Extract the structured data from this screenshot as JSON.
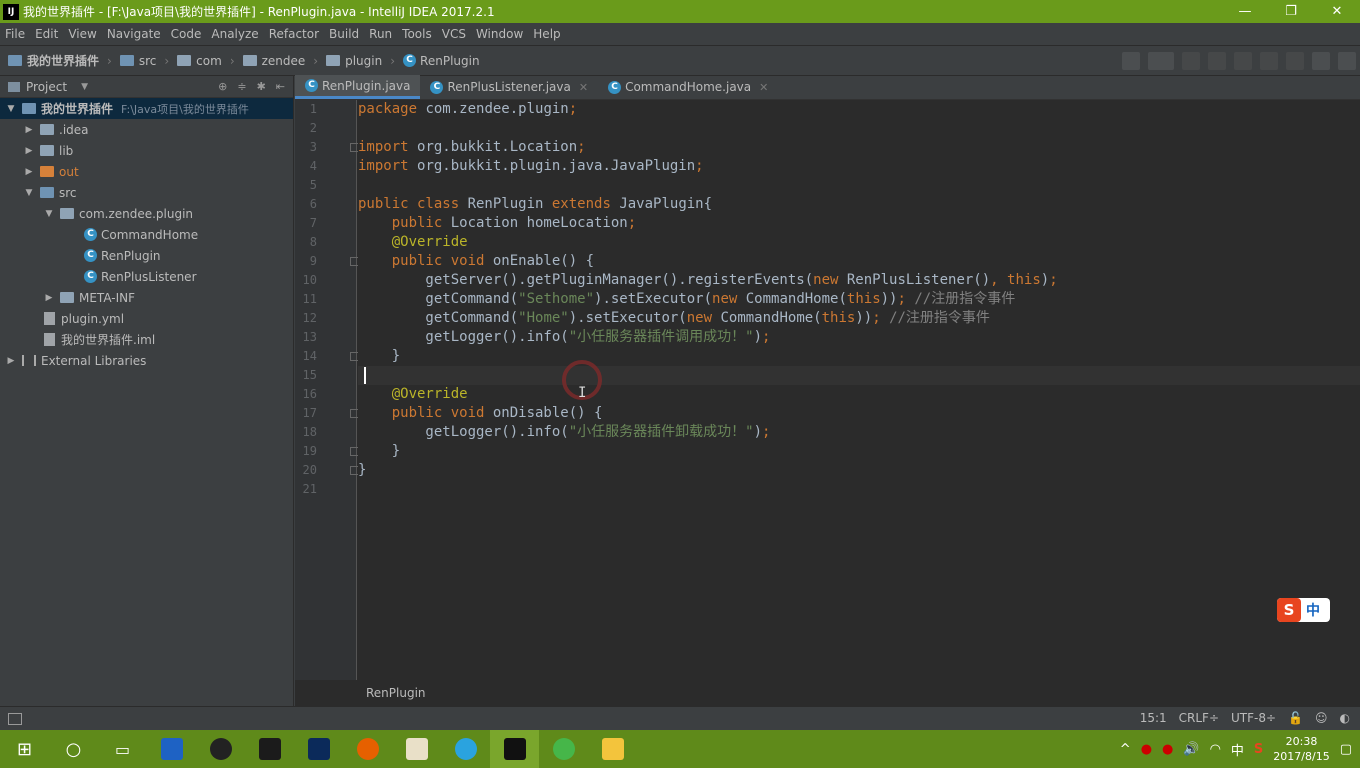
{
  "window": {
    "title": "我的世界插件 - [F:\\Java项目\\我的世界插件] - RenPlugin.java - IntelliJ IDEA 2017.2.1",
    "app_icon": "IJ",
    "controls": [
      "—",
      "❐",
      "✕"
    ]
  },
  "menu": [
    "File",
    "Edit",
    "View",
    "Navigate",
    "Code",
    "Analyze",
    "Refactor",
    "Build",
    "Run",
    "Tools",
    "VCS",
    "Window",
    "Help"
  ],
  "breadcrumbs": [
    "我的世界插件",
    "src",
    "com",
    "zendee",
    "plugin",
    "RenPlugin"
  ],
  "project_panel": {
    "title": "Project",
    "tree": [
      {
        "label": "我的世界插件",
        "path": "F:\\Java项目\\我的世界插件",
        "type": "module"
      },
      {
        "label": ".idea",
        "type": "folder"
      },
      {
        "label": "lib",
        "type": "folder"
      },
      {
        "label": "out",
        "type": "folder-excluded"
      },
      {
        "label": "src",
        "type": "source-folder"
      },
      {
        "label": "com.zendee.plugin",
        "type": "package"
      },
      {
        "label": "CommandHome",
        "type": "class"
      },
      {
        "label": "RenPlugin",
        "type": "class"
      },
      {
        "label": "RenPlusListener",
        "type": "class"
      },
      {
        "label": "META-INF",
        "type": "folder"
      },
      {
        "label": "plugin.yml",
        "type": "file"
      },
      {
        "label": "我的世界插件.iml",
        "type": "file"
      },
      {
        "label": "External Libraries",
        "type": "library"
      }
    ]
  },
  "tabs": [
    {
      "label": "RenPlugin.java",
      "active": true
    },
    {
      "label": "RenPlusListener.java",
      "active": false
    },
    {
      "label": "CommandHome.java",
      "active": false
    }
  ],
  "code_lines": {
    "l1": [
      {
        "t": "package ",
        "c": "kw"
      },
      {
        "t": "com.zendee.plugin",
        "c": ""
      },
      {
        "t": ";",
        "c": "kw"
      }
    ],
    "l2": [],
    "l3": [
      {
        "t": "import ",
        "c": "kw"
      },
      {
        "t": "org.bukkit.Location",
        "c": ""
      },
      {
        "t": ";",
        "c": "kw"
      }
    ],
    "l4": [
      {
        "t": "import ",
        "c": "kw"
      },
      {
        "t": "org.bukkit.plugin.java.JavaPlugin",
        "c": ""
      },
      {
        "t": ";",
        "c": "kw"
      }
    ],
    "l5": [],
    "l6": [
      {
        "t": "public class ",
        "c": "kw"
      },
      {
        "t": "RenPlugin ",
        "c": ""
      },
      {
        "t": "extends ",
        "c": "kw"
      },
      {
        "t": "JavaPlugin{",
        "c": ""
      }
    ],
    "l7": [
      {
        "t": "    public ",
        "c": "kw"
      },
      {
        "t": "Location homeLocation",
        "c": ""
      },
      {
        "t": ";",
        "c": "kw"
      }
    ],
    "l8": [
      {
        "t": "    @Override",
        "c": "ann"
      }
    ],
    "l9": [
      {
        "t": "    public void ",
        "c": "kw"
      },
      {
        "t": "onEnable() {",
        "c": ""
      }
    ],
    "l10": [
      {
        "t": "        getServer().getPluginManager().registerEvents(",
        "c": ""
      },
      {
        "t": "new ",
        "c": "kw"
      },
      {
        "t": "RenPlusListener()",
        "c": ""
      },
      {
        "t": ", this",
        "c": "kw"
      },
      {
        "t": ")",
        "c": ""
      },
      {
        "t": ";",
        "c": "kw"
      }
    ],
    "l11": [
      {
        "t": "        getCommand(",
        "c": ""
      },
      {
        "t": "\"Sethome\"",
        "c": "str"
      },
      {
        "t": ").setExecutor(",
        "c": ""
      },
      {
        "t": "new ",
        "c": "kw"
      },
      {
        "t": "CommandHome(",
        "c": ""
      },
      {
        "t": "this",
        "c": "kw"
      },
      {
        "t": "))",
        "c": ""
      },
      {
        "t": "; ",
        "c": "kw"
      },
      {
        "t": "//注册指令事件",
        "c": "cmt"
      }
    ],
    "l12": [
      {
        "t": "        getCommand(",
        "c": ""
      },
      {
        "t": "\"Home\"",
        "c": "str"
      },
      {
        "t": ").setExecutor(",
        "c": ""
      },
      {
        "t": "new ",
        "c": "kw"
      },
      {
        "t": "CommandHome(",
        "c": ""
      },
      {
        "t": "this",
        "c": "kw"
      },
      {
        "t": "))",
        "c": ""
      },
      {
        "t": "; ",
        "c": "kw"
      },
      {
        "t": "//注册指令事件",
        "c": "cmt"
      }
    ],
    "l13": [
      {
        "t": "        getLogger().info(",
        "c": ""
      },
      {
        "t": "\"小任服务器插件调用成功！\"",
        "c": "str"
      },
      {
        "t": ")",
        "c": ""
      },
      {
        "t": ";",
        "c": "kw"
      }
    ],
    "l14": [
      {
        "t": "    }",
        "c": ""
      }
    ],
    "l15": [],
    "l16": [
      {
        "t": "    @Override",
        "c": "ann"
      }
    ],
    "l17": [
      {
        "t": "    public void ",
        "c": "kw"
      },
      {
        "t": "onDisable() {",
        "c": ""
      }
    ],
    "l18": [
      {
        "t": "        getLogger().info(",
        "c": ""
      },
      {
        "t": "\"小任服务器插件卸载成功！\"",
        "c": "str"
      },
      {
        "t": ")",
        "c": ""
      },
      {
        "t": ";",
        "c": "kw"
      }
    ],
    "l19": [
      {
        "t": "    }",
        "c": ""
      }
    ],
    "l20": [
      {
        "t": "}",
        "c": ""
      }
    ],
    "l21": []
  },
  "line_numbers": [
    "1",
    "2",
    "3",
    "4",
    "5",
    "6",
    "7",
    "8",
    "9",
    "10",
    "11",
    "12",
    "13",
    "14",
    "15",
    "16",
    "17",
    "18",
    "19",
    "20",
    "21"
  ],
  "editor_breadcrumb": "RenPlugin",
  "status": {
    "position": "15:1",
    "line_separator": "CRLF÷",
    "encoding": "UTF-8÷"
  },
  "ime": {
    "logo": "S",
    "mode": "中"
  },
  "taskbar": {
    "time": "20:38",
    "date": "2017/8/15",
    "ime_indicator": "中"
  },
  "colors": {
    "titlebar": "#6a9b1b",
    "taskbar": "#5f8a1a",
    "editor_bg": "#2b2b2b",
    "keyword": "#cc7832",
    "string": "#6a8759",
    "comment": "#808080",
    "annotation": "#bbb529"
  }
}
